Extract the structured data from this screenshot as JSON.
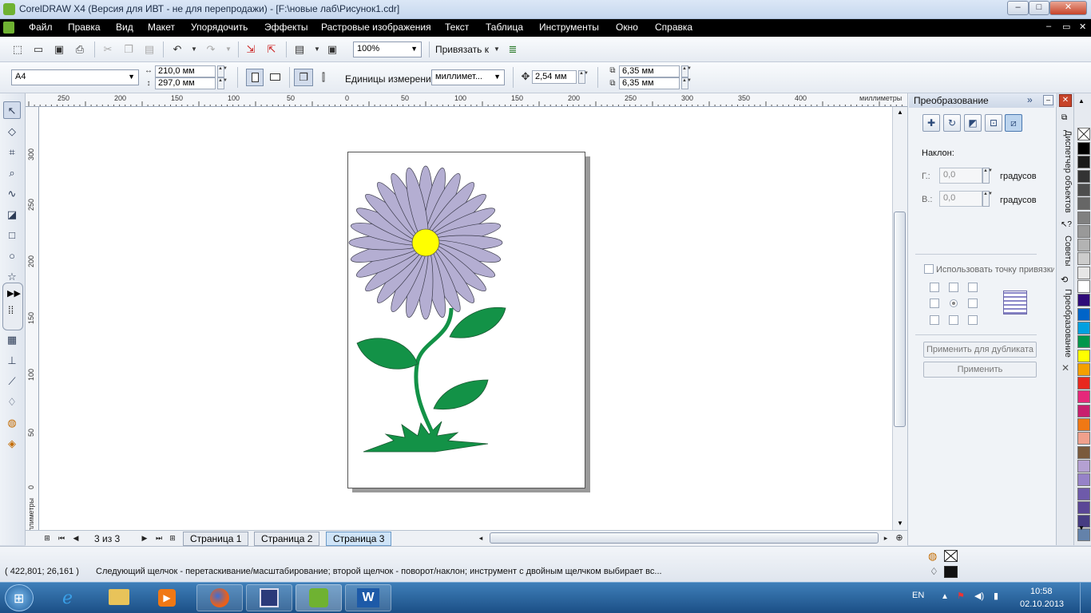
{
  "window": {
    "title": "CorelDRAW X4 (Версия для ИВТ - не для перепродажи) - [F:\\новые лаб\\Рисунок1.cdr]",
    "controls": {
      "minimize": "–",
      "maximize": "□",
      "close": "✕"
    }
  },
  "menu": {
    "items": [
      "Файл",
      "Правка",
      "Вид",
      "Макет",
      "Упорядочить",
      "Эффекты",
      "Растровые изображения",
      "Текст",
      "Таблица",
      "Инструменты",
      "Окно",
      "Справка"
    ],
    "doc_controls": {
      "minimize": "–",
      "restore": "▭",
      "close": "✕"
    }
  },
  "standard_toolbar": {
    "zoom_value": "100%",
    "snap_label": "Привязать к"
  },
  "property_bar": {
    "paper_size": "A4",
    "width": "210,0 мм",
    "height": "297,0 мм",
    "units_label": "Единицы измерения:",
    "units_value": "миллимет...",
    "nudge": "2,54 мм",
    "duplicate_x": "6,35 мм",
    "duplicate_y": "6,35 мм"
  },
  "ruler": {
    "h_ticks": [
      "250",
      "200",
      "150",
      "100",
      "50",
      "0",
      "50",
      "100",
      "150",
      "200",
      "250",
      "300",
      "350",
      "400"
    ],
    "h_unit": "миллиметры",
    "v_ticks": [
      "300",
      "250",
      "200",
      "150",
      "100",
      "50",
      "0"
    ],
    "v_unit": "миллиметры"
  },
  "page_navigator": {
    "counter": "3 из 3",
    "tabs": [
      "Страница 1",
      "Страница 2",
      "Страница 3"
    ],
    "active_tab": 2
  },
  "docker": {
    "title": "Преобразование",
    "section_label": "Наклон:",
    "h_label": "Г.:",
    "h_value": "0,0",
    "v_label": "В.:",
    "v_value": "0,0",
    "unit": "градусов",
    "anchor_label": "Использовать точку привязки",
    "apply_duplicate": "Применить для дубликата",
    "apply": "Применить"
  },
  "side_tabs": [
    "Диспетчер объектов",
    "Советы",
    "Преобразование"
  ],
  "palette": [
    "#ffffff",
    "#000000",
    "#1a1a1a",
    "#333333",
    "#4d4d4d",
    "#666666",
    "#808080",
    "#999999",
    "#b3b3b3",
    "#cccccc",
    "#e6e6e6",
    "#ffffff",
    "#2e0a78",
    "#0064c8",
    "#00a0e0",
    "#00964b",
    "#ffff00",
    "#f5a000",
    "#e8281e",
    "#e6287a",
    "#c81e6e",
    "#f07814",
    "#f0a08c",
    "#7a5a3c",
    "#b4a0d2",
    "#9682c8",
    "#6e5aaa",
    "#5a4696",
    "#463c82",
    "#6482aa"
  ],
  "status": {
    "coords": "( 422,801; 26,161 )",
    "message": "Следующий щелчок - перетаскивание/масштабирование; второй щелчок - поворот/наклон; инструмент с двойным щелчком выбирает вс..."
  },
  "taskbar": {
    "lang": "EN",
    "time": "10:58",
    "date": "02.10.2013"
  },
  "colors": {
    "petal": "#b4aed2",
    "center": "#ffff00",
    "leaf": "#139247"
  }
}
